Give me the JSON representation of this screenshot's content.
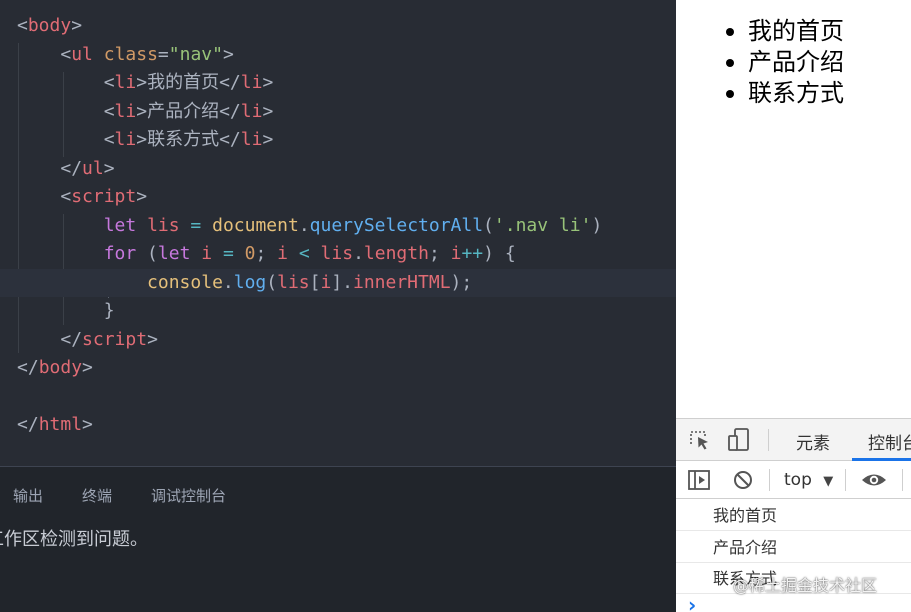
{
  "editor": {
    "lines": [
      [
        [
          "tk-punc",
          "<"
        ],
        [
          "tk-tag",
          "body"
        ],
        [
          "tk-punc",
          ">"
        ]
      ],
      [
        [
          "tk-text",
          "    "
        ],
        [
          "tk-punc",
          "<"
        ],
        [
          "tk-tag",
          "ul"
        ],
        [
          "tk-text",
          " "
        ],
        [
          "tk-attr",
          "class"
        ],
        [
          "tk-punc",
          "="
        ],
        [
          "tk-str",
          "\"nav\""
        ],
        [
          "tk-punc",
          ">"
        ]
      ],
      [
        [
          "tk-text",
          "        "
        ],
        [
          "tk-punc",
          "<"
        ],
        [
          "tk-tag",
          "li"
        ],
        [
          "tk-punc",
          ">"
        ],
        [
          "tk-text",
          "我的首页"
        ],
        [
          "tk-punc",
          "</"
        ],
        [
          "tk-tag",
          "li"
        ],
        [
          "tk-punc",
          ">"
        ]
      ],
      [
        [
          "tk-text",
          "        "
        ],
        [
          "tk-punc",
          "<"
        ],
        [
          "tk-tag",
          "li"
        ],
        [
          "tk-punc",
          ">"
        ],
        [
          "tk-text",
          "产品介绍"
        ],
        [
          "tk-punc",
          "</"
        ],
        [
          "tk-tag",
          "li"
        ],
        [
          "tk-punc",
          ">"
        ]
      ],
      [
        [
          "tk-text",
          "        "
        ],
        [
          "tk-punc",
          "<"
        ],
        [
          "tk-tag",
          "li"
        ],
        [
          "tk-punc",
          ">"
        ],
        [
          "tk-text",
          "联系方式"
        ],
        [
          "tk-punc",
          "</"
        ],
        [
          "tk-tag",
          "li"
        ],
        [
          "tk-punc",
          ">"
        ]
      ],
      [
        [
          "tk-text",
          "    "
        ],
        [
          "tk-punc",
          "</"
        ],
        [
          "tk-tag",
          "ul"
        ],
        [
          "tk-punc",
          ">"
        ]
      ],
      [
        [
          "tk-text",
          "    "
        ],
        [
          "tk-punc",
          "<"
        ],
        [
          "tk-tag",
          "script"
        ],
        [
          "tk-punc",
          ">"
        ]
      ],
      [
        [
          "tk-text",
          "        "
        ],
        [
          "tk-kw",
          "let"
        ],
        [
          "tk-text",
          " "
        ],
        [
          "tk-var",
          "lis"
        ],
        [
          "tk-text",
          " "
        ],
        [
          "tk-op",
          "="
        ],
        [
          "tk-text",
          " "
        ],
        [
          "tk-obj",
          "document"
        ],
        [
          "tk-punc",
          "."
        ],
        [
          "tk-fn",
          "querySelectorAll"
        ],
        [
          "tk-punc",
          "("
        ],
        [
          "tk-str",
          "'.nav li'"
        ],
        [
          "tk-punc",
          ")"
        ]
      ],
      [
        [
          "tk-text",
          "        "
        ],
        [
          "tk-kw",
          "for"
        ],
        [
          "tk-text",
          " ("
        ],
        [
          "tk-kw",
          "let"
        ],
        [
          "tk-text",
          " "
        ],
        [
          "tk-var",
          "i"
        ],
        [
          "tk-text",
          " "
        ],
        [
          "tk-op",
          "="
        ],
        [
          "tk-text",
          " "
        ],
        [
          "tk-num",
          "0"
        ],
        [
          "tk-text",
          "; "
        ],
        [
          "tk-var",
          "i"
        ],
        [
          "tk-text",
          " "
        ],
        [
          "tk-op",
          "<"
        ],
        [
          "tk-text",
          " "
        ],
        [
          "tk-var",
          "lis"
        ],
        [
          "tk-punc",
          "."
        ],
        [
          "tk-var",
          "length"
        ],
        [
          "tk-text",
          "; "
        ],
        [
          "tk-var",
          "i"
        ],
        [
          "tk-op",
          "++"
        ],
        [
          "tk-text",
          ") {"
        ]
      ],
      [
        [
          "tk-text",
          "            "
        ],
        [
          "tk-obj",
          "console"
        ],
        [
          "tk-punc",
          "."
        ],
        [
          "tk-fn",
          "log"
        ],
        [
          "tk-punc",
          "("
        ],
        [
          "tk-var",
          "lis"
        ],
        [
          "tk-punc",
          "["
        ],
        [
          "tk-var",
          "i"
        ],
        [
          "tk-punc",
          "]."
        ],
        [
          "tk-var",
          "innerHTML"
        ],
        [
          "tk-punc",
          ");"
        ]
      ],
      [
        [
          "tk-text",
          "        }"
        ]
      ],
      [
        [
          "tk-text",
          "    "
        ],
        [
          "tk-punc",
          "</"
        ],
        [
          "tk-tag",
          "script"
        ],
        [
          "tk-punc",
          ">"
        ]
      ],
      [
        [
          "tk-punc",
          "</"
        ],
        [
          "tk-tag",
          "body"
        ],
        [
          "tk-punc",
          ">"
        ]
      ],
      [],
      [
        [
          "tk-punc",
          "</"
        ],
        [
          "tk-tag",
          "html"
        ],
        [
          "tk-punc",
          ">"
        ]
      ]
    ],
    "active_line": 9
  },
  "panel": {
    "tabs": [
      "输出",
      "终端",
      "调试控制台"
    ],
    "message": "工作区检测到问题。"
  },
  "page": {
    "nav_items": [
      "我的首页",
      "产品介绍",
      "联系方式"
    ]
  },
  "devtools": {
    "tabs": [
      "元素",
      "控制台"
    ],
    "active_tab": "控制台",
    "context": "top",
    "context_arrow": "▼",
    "logs": [
      "我的首页",
      "产品介绍",
      "联系方式"
    ],
    "prompt": "›",
    "accent": "#1a73e8",
    "icons": [
      "inspect-icon",
      "device-toggle-icon",
      "sidebar-toggle-icon",
      "clear-console-icon",
      "eye-icon"
    ]
  },
  "watermark": "@稀土掘金技术社区"
}
